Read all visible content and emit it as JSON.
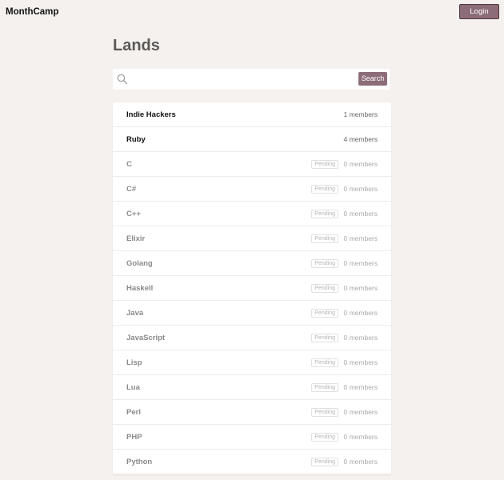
{
  "app": {
    "brand": "MonthCamp",
    "login_label": "Login"
  },
  "page": {
    "title": "Lands"
  },
  "search": {
    "placeholder": "",
    "value": "",
    "button_label": "Search"
  },
  "lands": [
    {
      "name": "Indie Hackers",
      "members": "1 members",
      "status": "",
      "active": true
    },
    {
      "name": "Ruby",
      "members": "4 members",
      "status": "",
      "active": true
    },
    {
      "name": "C",
      "members": "0 members",
      "status": "Pending",
      "active": false
    },
    {
      "name": "C#",
      "members": "0 members",
      "status": "Pending",
      "active": false
    },
    {
      "name": "C++",
      "members": "0 members",
      "status": "Pending",
      "active": false
    },
    {
      "name": "Elixir",
      "members": "0 members",
      "status": "Pending",
      "active": false
    },
    {
      "name": "Golang",
      "members": "0 members",
      "status": "Pending",
      "active": false
    },
    {
      "name": "Haskell",
      "members": "0 members",
      "status": "Pending",
      "active": false
    },
    {
      "name": "Java",
      "members": "0 members",
      "status": "Pending",
      "active": false
    },
    {
      "name": "JavaScript",
      "members": "0 members",
      "status": "Pending",
      "active": false
    },
    {
      "name": "Lisp",
      "members": "0 members",
      "status": "Pending",
      "active": false
    },
    {
      "name": "Lua",
      "members": "0 members",
      "status": "Pending",
      "active": false
    },
    {
      "name": "Perl",
      "members": "0 members",
      "status": "Pending",
      "active": false
    },
    {
      "name": "PHP",
      "members": "0 members",
      "status": "Pending",
      "active": false
    },
    {
      "name": "Python",
      "members": "0 members",
      "status": "Pending",
      "active": false
    }
  ],
  "colors": {
    "background": "#f5f1ee",
    "accent": "#8c6c78",
    "card": "#ffffff"
  }
}
